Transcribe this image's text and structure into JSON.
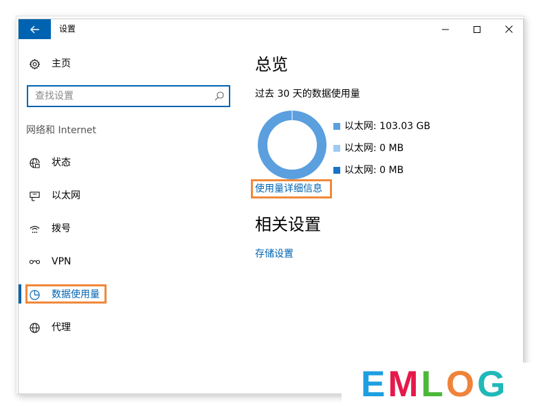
{
  "window": {
    "title": "设置",
    "back_icon": "arrow-left-icon",
    "controls": [
      "minimize-icon",
      "maximize-icon",
      "close-icon"
    ]
  },
  "sidebar": {
    "home_label": "主页",
    "search": {
      "placeholder": "查找设置",
      "value": ""
    },
    "section_heading": "网络和 Internet",
    "items": [
      {
        "label": "状态",
        "icon": "globe-status-icon"
      },
      {
        "label": "以太网",
        "icon": "ethernet-icon"
      },
      {
        "label": "拨号",
        "icon": "dialup-icon"
      },
      {
        "label": "VPN",
        "icon": "vpn-icon"
      },
      {
        "label": "数据使用量",
        "icon": "pie-chart-icon",
        "selected": true
      },
      {
        "label": "代理",
        "icon": "proxy-globe-icon"
      }
    ]
  },
  "main": {
    "title": "总览",
    "usage_caption": "过去 30 天的数据使用量",
    "details_link": "使用量详细信息",
    "related_title": "相关设置",
    "storage_link": "存储设置"
  },
  "chart_data": {
    "type": "pie",
    "categories": [
      "以太网: 103.03 GB",
      "以太网: 0 MB",
      "以太网: 0 MB"
    ],
    "values": [
      103.03,
      0,
      0
    ],
    "colors": [
      "#5b9fde",
      "#9fcaf0",
      "#1a73c8"
    ],
    "legend": "right"
  },
  "watermark": {
    "letters": [
      "E",
      "M",
      "L",
      "O",
      "G"
    ],
    "colors": [
      "#1e9fe0",
      "#e6194b",
      "#4cb83a",
      "#f0823a",
      "#21b8b8"
    ]
  },
  "accent": "#0063b1",
  "highlight": "#f0883a"
}
